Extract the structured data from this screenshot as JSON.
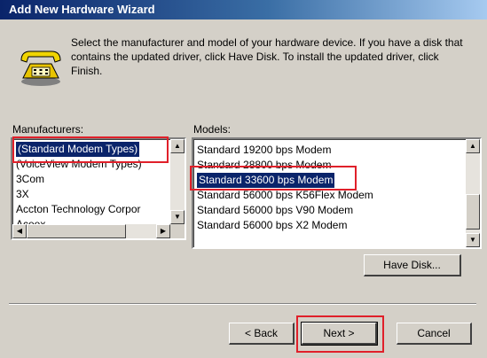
{
  "window": {
    "title": "Add New Hardware Wizard"
  },
  "instructions": "Select the manufacturer and model of your hardware device. If you have a disk that contains the updated driver, click Have Disk. To install the updated driver, click Finish.",
  "manufacturers": {
    "label": "Manufacturers:",
    "items": [
      "(Standard Modem Types)",
      "(VoiceView Modem Types)",
      "3Com",
      "3X",
      "Accton Technology Corpor",
      "Aceex"
    ],
    "selected": "(Standard Modem Types)"
  },
  "models": {
    "label": "Models:",
    "items": [
      "Standard 19200 bps Modem",
      "Standard 28800 bps Modem",
      "Standard 33600 bps Modem",
      "Standard 56000 bps K56Flex Modem",
      "Standard 56000 bps V90 Modem",
      "Standard 56000 bps X2 Modem"
    ],
    "selected": "Standard 33600 bps Modem"
  },
  "buttons": {
    "have_disk": "Have Disk...",
    "back": "< Back",
    "next": "Next >",
    "cancel": "Cancel"
  },
  "colors": {
    "title_bar": "#0a246a",
    "selection": "#0a246a",
    "highlight_box": "#e0202a",
    "dialog_face": "#d4d0c8"
  },
  "icons": {
    "wizard": "telephone-modem-icon",
    "scroll_up": "arrow-up-icon",
    "scroll_down": "arrow-down-icon",
    "scroll_left": "arrow-left-icon",
    "scroll_right": "arrow-right-icon"
  }
}
